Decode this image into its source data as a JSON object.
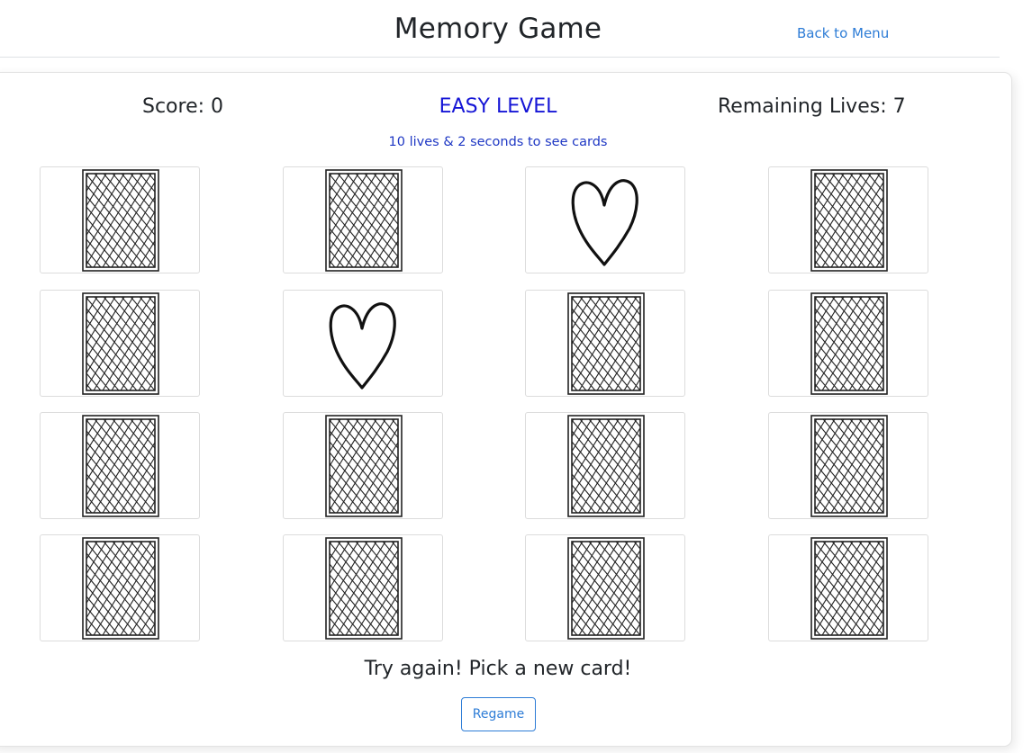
{
  "header": {
    "title": "Memory Game",
    "back_link": "Back to Menu"
  },
  "stats": {
    "score": "Score: 0",
    "level": "EASY LEVEL",
    "level_description": "10 lives & 2 seconds to see cards",
    "lives": "Remaining Lives: 7"
  },
  "cards": [
    {
      "face": "back"
    },
    {
      "face": "back"
    },
    {
      "face": "heart"
    },
    {
      "face": "back"
    },
    {
      "face": "back"
    },
    {
      "face": "heart"
    },
    {
      "face": "back"
    },
    {
      "face": "back"
    },
    {
      "face": "back"
    },
    {
      "face": "back"
    },
    {
      "face": "back"
    },
    {
      "face": "back"
    },
    {
      "face": "back"
    },
    {
      "face": "back"
    },
    {
      "face": "back"
    },
    {
      "face": "back"
    }
  ],
  "message": "Try again! Pick a new card!",
  "regame_button": "Regame",
  "colors": {
    "link": "#2d7cd6",
    "level": "#1515d6",
    "level_description": "#1f38c4"
  }
}
